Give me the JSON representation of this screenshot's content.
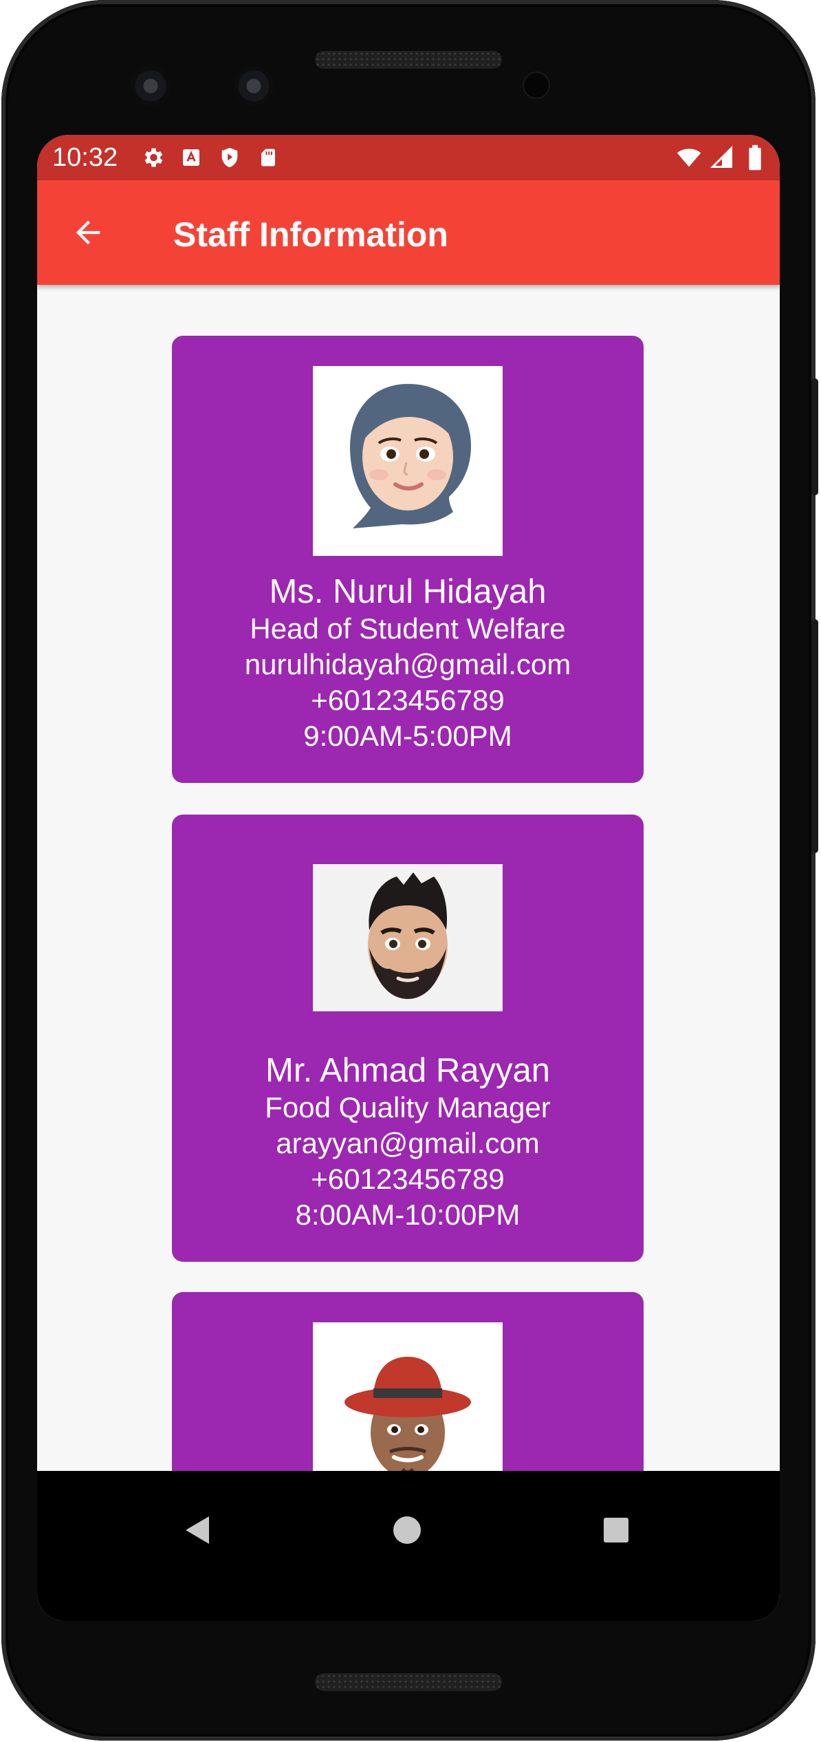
{
  "status_bar": {
    "time": "10:32",
    "left_icons": [
      "settings-icon",
      "keyboard-icon",
      "shield-play-icon",
      "sd-card-icon"
    ],
    "right_icons": [
      "wifi-icon",
      "cell-signal-icon",
      "battery-icon"
    ]
  },
  "app_bar": {
    "title": "Staff Information",
    "back_icon": "arrow-back-icon",
    "color": "#f44336"
  },
  "staff": [
    {
      "name": "Ms. Nurul Hidayah",
      "role": "Head of Student Welfare",
      "email": "nurulhidayah@gmail.com",
      "phone": "+60123456789",
      "hours": "9:00AM-5:00PM"
    },
    {
      "name": "Mr. Ahmad Rayyan",
      "role": "Food Quality Manager",
      "email": "arayyan@gmail.com",
      "phone": "+60123456789",
      "hours": "8:00AM-10:00PM"
    },
    {
      "name": "",
      "role": "",
      "email": "",
      "phone": "",
      "hours": ""
    }
  ],
  "card_color": "#9c27b0",
  "nav_bar": {
    "icons": [
      "nav-back-icon",
      "nav-home-icon",
      "nav-recents-icon"
    ]
  }
}
